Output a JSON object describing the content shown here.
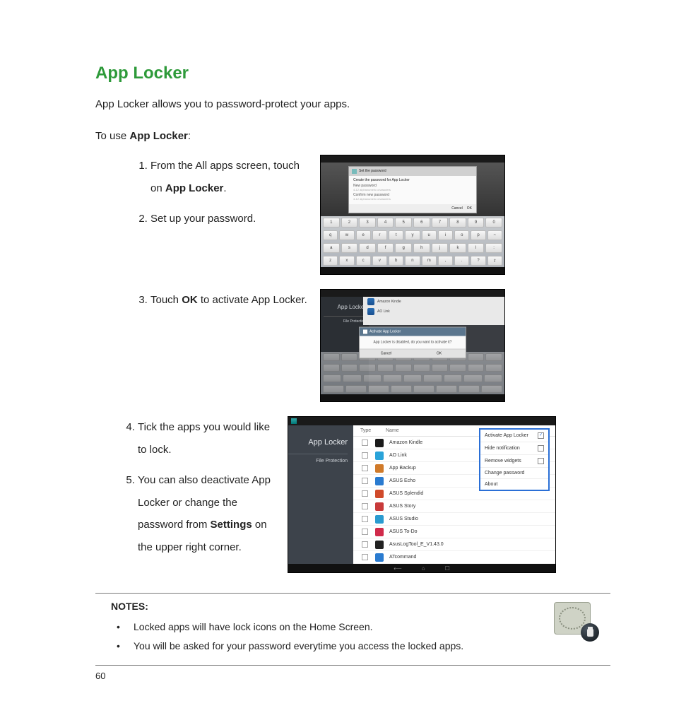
{
  "title": "App Locker",
  "intro": "App Locker allows you to password-protect your apps.",
  "lead_pre": "To use ",
  "lead_bold": "App Locker",
  "lead_post": ":",
  "steps": {
    "s1_pre": "From the All apps screen, touch on ",
    "s1_bold": "App Locker",
    "s1_post": ".",
    "s2": "Set up your password.",
    "s3_pre": "Touch ",
    "s3_bold": "OK",
    "s3_post": " to activate App Locker.",
    "s4": "Tick the apps you would like to lock.",
    "s5_pre": "You can also deactivate App Locker or change the password from ",
    "s5_bold": "Settings",
    "s5_post": " on the upper right corner."
  },
  "shot1": {
    "dlg_title": "Set the password",
    "dlg_hint_title": "Create the password for App Locker",
    "fld1_label": "New password",
    "fld1_hint": "4-12 alphanumeric characters",
    "fld2_label": "Confirm new password",
    "fld2_hint": "4-12 alphanumeric characters",
    "btn_cancel": "Cancel",
    "btn_ok": "OK",
    "kb_r1": [
      "1",
      "2",
      "3",
      "4",
      "5",
      "6",
      "7",
      "8",
      "9",
      "0"
    ],
    "kb_r2": [
      "q",
      "w",
      "e",
      "r",
      "t",
      "y",
      "u",
      "i",
      "o",
      "p",
      "~"
    ],
    "kb_r3": [
      "a",
      "s",
      "d",
      "f",
      "g",
      "h",
      "j",
      "k",
      "l",
      ":"
    ],
    "kb_r4": [
      "z",
      "x",
      "c",
      "v",
      "b",
      "n",
      "m",
      ",",
      ".",
      "?",
      "⇧"
    ]
  },
  "shot2": {
    "side_title": "App Locker",
    "side_sub": "File Protection",
    "list": [
      "Amazon Kindle",
      "AO Link"
    ],
    "dlg_title": "Activate App Locker",
    "dlg_body": "App Locker is disabled, do you want to activate it?",
    "btn_cancel": "Cancel",
    "btn_ok": "OK"
  },
  "shot3": {
    "side_title": "App Locker",
    "side_sub": "File Protection",
    "col_type": "Type",
    "col_name": "Name",
    "apps": [
      {
        "name": "Amazon Kindle",
        "color": "#1a1a1a"
      },
      {
        "name": "AO Link",
        "color": "#2aa3d9"
      },
      {
        "name": "App Backup",
        "color": "#d07a2a"
      },
      {
        "name": "ASUS Echo",
        "color": "#2a7bd0"
      },
      {
        "name": "ASUS Splendid",
        "color": "#d04a2a"
      },
      {
        "name": "ASUS Story",
        "color": "#c83a3a"
      },
      {
        "name": "ASUS Studio",
        "color": "#2a9bd0"
      },
      {
        "name": "ASUS To-Do",
        "color": "#d02a4a"
      },
      {
        "name": "AsusLogTool_E_V1.43.0",
        "color": "#222"
      },
      {
        "name": "ATcommand",
        "color": "#2a7bd0"
      }
    ],
    "menu": {
      "m1": "Activate App Locker",
      "m2": "Hide notification",
      "m3": "Remove widgets",
      "m4": "Change password",
      "m5": "About"
    }
  },
  "notes": {
    "title": "NOTES:",
    "n1": "Locked apps will have lock icons on the Home Screen.",
    "n2": "You will be asked for your password everytime you access the locked apps."
  },
  "page_number": "60"
}
